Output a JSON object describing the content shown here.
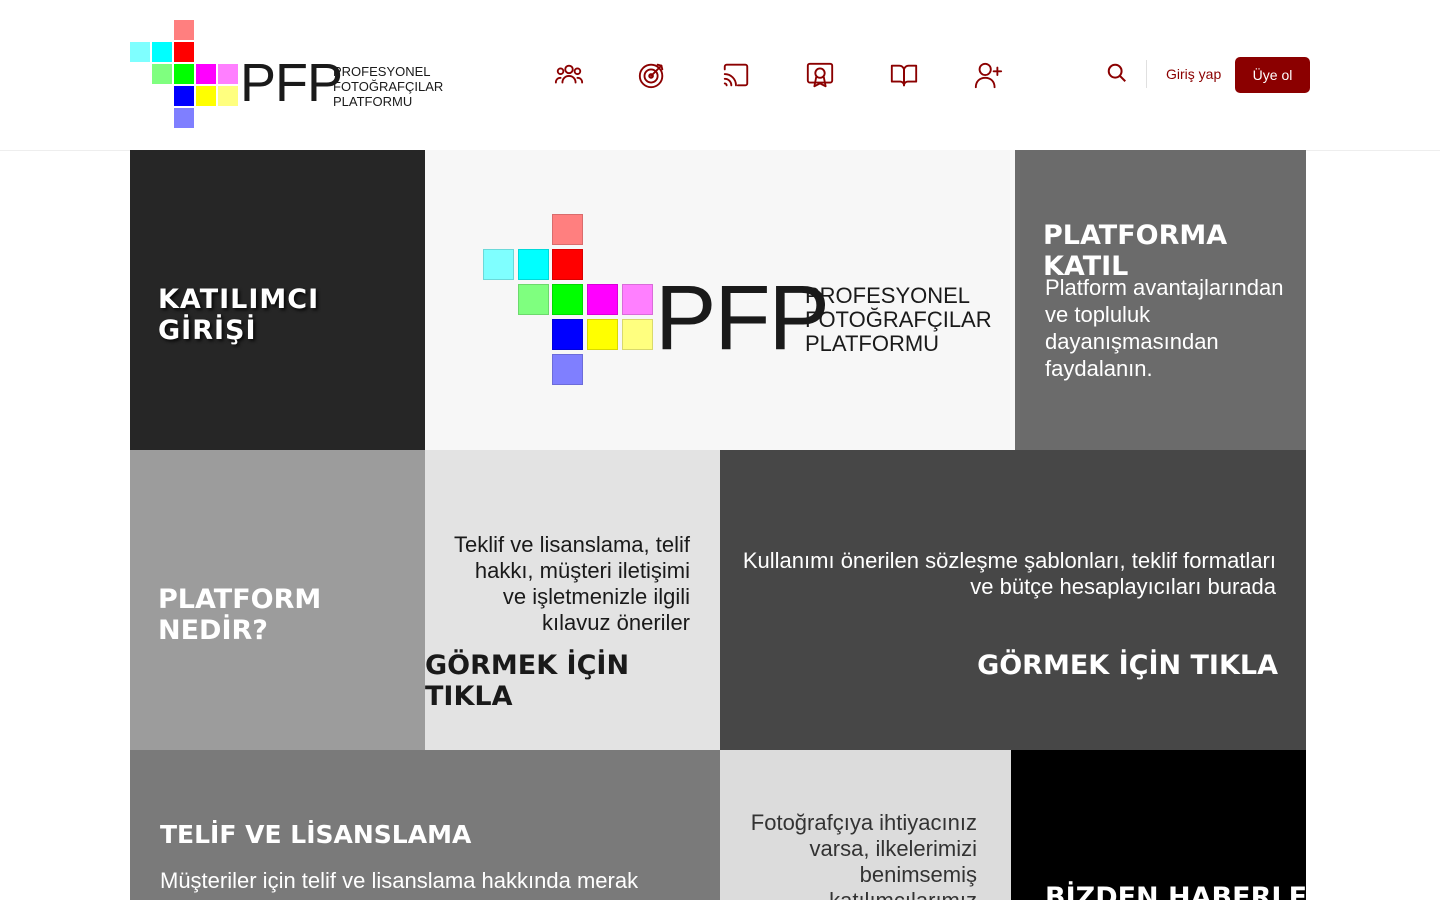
{
  "header": {
    "logo": {
      "mark": "PFP",
      "line1": "PROFESYONEL",
      "line2": "FOTOĞRAFÇILAR",
      "line3": "PLATFORMU"
    },
    "nav_icons": [
      "users-icon",
      "target-icon",
      "cast-icon",
      "certificate-icon",
      "book-icon",
      "add-user-icon"
    ],
    "search_icon": "search-icon",
    "login_label": "Giriş yap",
    "signup_label": "Üye ol",
    "accent_color": "#8b0000"
  },
  "tiles": {
    "participant_login": {
      "title": "KATILIMCI GİRİŞİ",
      "bg": "#262626"
    },
    "hero": {
      "mark": "PFP",
      "line1": "PROFESYONEL",
      "line2": "FOTOĞRAFÇILAR",
      "line3": "PLATFORMU",
      "bg": "#f7f7f7"
    },
    "join": {
      "title": "PLATFORMA KATIL",
      "text": "Platform avantajlarından ve topluluk dayanışmasından faydalanın.",
      "bg": "#6b6b6b"
    },
    "what_is": {
      "title": "PLATFORM NEDİR?",
      "bg": "#9c9c9c"
    },
    "guides": {
      "text": "Teklif ve lisanslama, telif hakkı, müşteri iletişimi ve işletmenizle ilgili kılavuz öneriler",
      "cta": "GÖRMEK İÇİN TIKLA",
      "bg": "#e3e3e3"
    },
    "templates": {
      "text": "Kullanımı önerilen sözleşme şablonları, teklif formatları ve bütçe hesaplayıcıları burada",
      "cta": "GÖRMEK İÇİN TIKLA",
      "bg": "#474747"
    },
    "copyright": {
      "title": "TELİF VE LİSANSLAMA",
      "text": "Müşteriler için telif ve lisanslama hakkında merak",
      "bg": "#7a7a7a"
    },
    "need_photographer": {
      "text": "Fotoğrafçıya ihtiyacınız varsa, ilkelerimizi benimsemiş katılımcılarımız arasından",
      "bg": "#dcdcdc"
    },
    "news": {
      "title": "BİZDEN HABERLER",
      "bg": "#000000"
    }
  }
}
